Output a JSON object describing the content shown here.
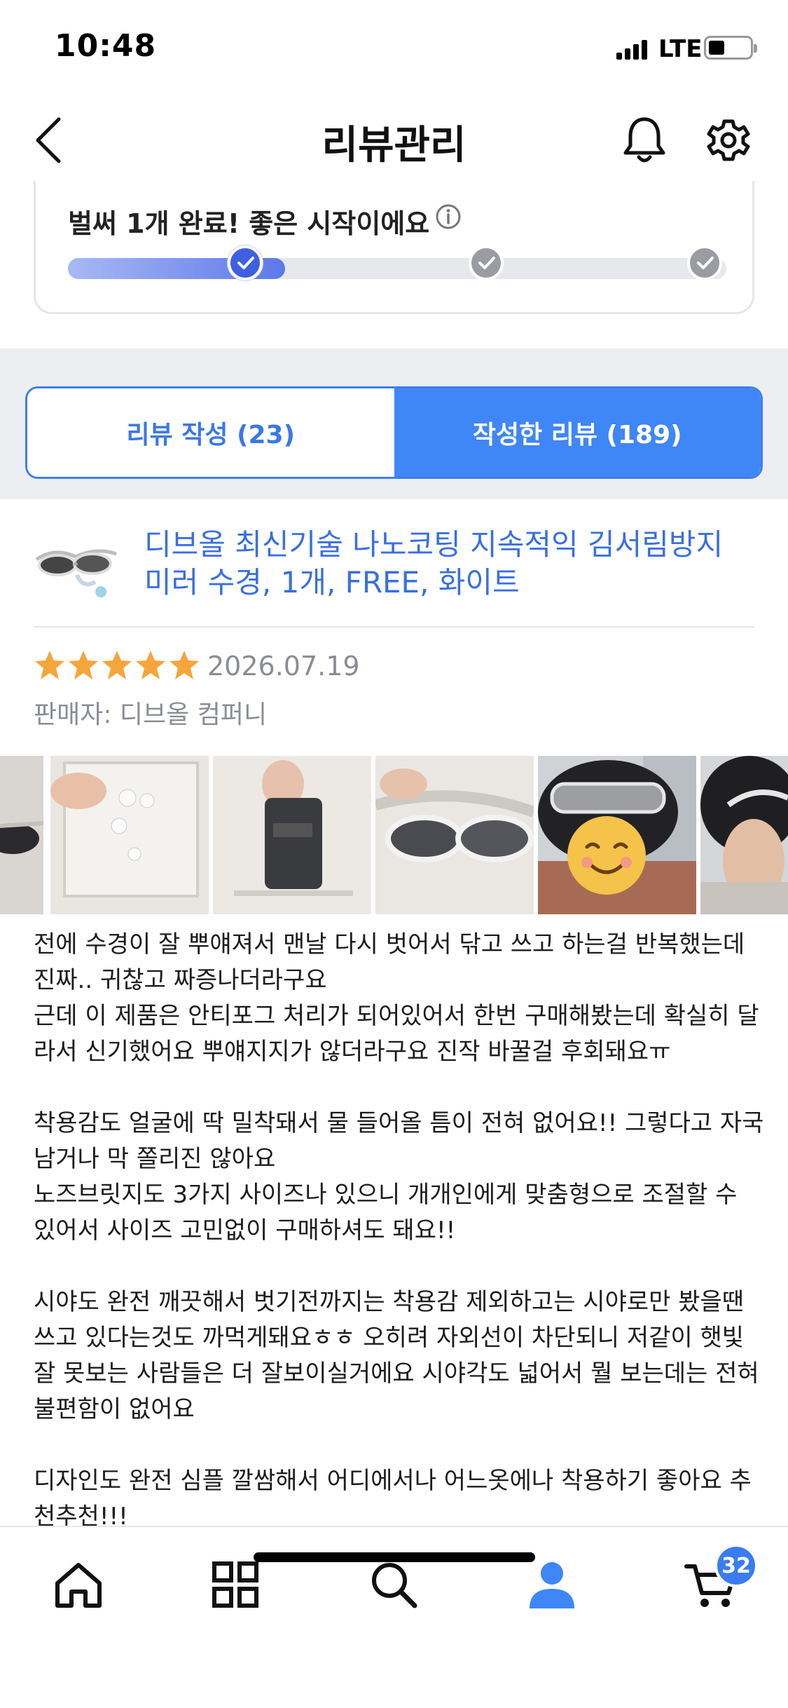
{
  "status_bar": {
    "time": "10:48",
    "network": "LTE",
    "battery_level": 0.3
  },
  "header": {
    "title": "리뷰관리",
    "back_icon": "chevron-left-icon",
    "bell_icon": "bell-icon",
    "gear_icon": "gear-icon"
  },
  "progress": {
    "message": "벌써 1개 완료! 좋은 시작이에요",
    "info_icon": "info-circle-icon",
    "completed_fraction": 0.33,
    "steps_total": 3,
    "steps_done": 1
  },
  "tabs": [
    {
      "label": "리뷰 작성 (23)",
      "active": false
    },
    {
      "label": "작성한 리뷰 (189)",
      "active": true
    }
  ],
  "review": {
    "product_name_line1": "디브올 최신기술 나노코팅 지속적익 김서림방지",
    "product_name_line2": "미러 수경, 1개, FREE, 화이트",
    "rating": 5,
    "date": "2026.07.19",
    "seller": "판매자: 디브올 컴퍼니",
    "photo_count": 6,
    "body_lines": [
      "전에 수경이 잘 뿌얘져서 맨날 다시 벗어서 닦고 쓰고 하는걸 반복했는데",
      "진짜.. 귀찮고 짜증나더라구요",
      "근데 이 제품은 안티포그 처리가 되어있어서 한번 구매해봤는데 확실히 달",
      "라서 신기했어요 뿌얘지지가 않더라구요 진작 바꿀걸 후회돼요ㅠ",
      "",
      "착용감도 얼굴에 딱 밀착돼서 물 들어올 틈이 전혀 없어요!! 그렇다고 자국",
      "남거나 막 쫄리진 않아요",
      "노즈브릿지도 3가지 사이즈나 있으니 개개인에게 맞춤형으로 조절할 수",
      "있어서 사이즈 고민없이 구매하셔도 돼요!!",
      "",
      "시야도 완전 깨끗해서 벗기전까지는 착용감 제외하고는 시야로만 봤을땐",
      "쓰고 있다는것도 까먹게돼요ㅎㅎ 오히려 자외선이 차단되니 저같이 햇빛",
      "잘 못보는 사람들은 더 잘보이실거에요 시야각도 넓어서 뭘 보는데는 전혀",
      "불편함이 없어요",
      "",
      "디자인도 완전 심플 깔쌈해서 어디에서나 어느옷에나 착용하기 좋아요 추",
      "천추천!!!"
    ]
  },
  "bottom_nav": {
    "items": [
      "home-icon",
      "grid-icon",
      "search-icon",
      "user-icon",
      "cart-icon"
    ],
    "active": "user-icon",
    "cart_count": "32"
  },
  "colors": {
    "accent": "#3f86f6",
    "link": "#3a6fe0",
    "star": "#f5a53c",
    "progress": "#3f5fe0"
  }
}
